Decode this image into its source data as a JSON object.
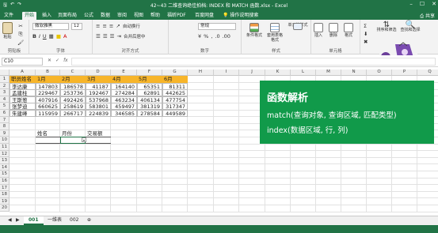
{
  "titlebar": {
    "title": "42~43 二维查询绝佳拍档: INDEX 和 MATCH 函数.xlsx - Excel"
  },
  "ribbon_tabs": [
    "文件",
    "开始",
    "插入",
    "页面布局",
    "公式",
    "数据",
    "审阅",
    "视图",
    "帮助",
    "福昕PDF",
    "百度网盘",
    "操作说明搜索"
  ],
  "share_label": "共享",
  "ribbon": {
    "paste": "粘贴",
    "font_name": "微软雅黑",
    "font_size": "12",
    "wrap": "自动换行",
    "merge": "合并后居中",
    "number_format": "常规",
    "cond_format": "条件格式",
    "as_table": "套用表格格式",
    "cell_style": "单元格样式",
    "insert": "插入",
    "delete": "删除",
    "format": "格式",
    "sort_filter": "排序和筛选",
    "find_select": "查找和选择",
    "groups": [
      "剪贴板",
      "字体",
      "对齐方式",
      "数字",
      "样式",
      "单元格",
      "编辑"
    ]
  },
  "name_box": "C10",
  "columns": [
    "A",
    "B",
    "C",
    "D",
    "E",
    "F",
    "G",
    "H",
    "I",
    "J",
    "K",
    "L",
    "M",
    "N",
    "O",
    "P",
    "Q"
  ],
  "rows": [
    "1",
    "2",
    "3",
    "4",
    "5",
    "6",
    "7",
    "8",
    "9",
    "10",
    "11",
    "12",
    "13",
    "14",
    "15",
    "16",
    "17",
    "18",
    "19",
    "20"
  ],
  "table": {
    "headers": [
      "职员姓名",
      "1月",
      "2月",
      "3月",
      "4月",
      "5月",
      "6月"
    ],
    "rows": [
      [
        "李达康",
        "147803",
        "186578",
        "41187",
        "164140",
        "65351",
        "81311"
      ],
      [
        "孟建柱",
        "229467",
        "253736",
        "192467",
        "274284",
        "62891",
        "442625"
      ],
      [
        "王斯葱",
        "407916",
        "492426",
        "537968",
        "463234",
        "406134",
        "477754"
      ],
      [
        "张梦迪",
        "660625",
        "258619",
        "583801",
        "459497",
        "381319",
        "317347"
      ],
      [
        "朱建峰",
        "115959",
        "266717",
        "224839",
        "346585",
        "278584",
        "449589"
      ]
    ]
  },
  "query": {
    "headers": [
      "姓名",
      "月份",
      "交易额"
    ]
  },
  "panel": {
    "title": "函数解析",
    "line1": "match(查询对象, 查询区域, 匹配类型)",
    "line2": "index(数据区域, 行, 列)"
  },
  "sheets": [
    "001",
    "一维表",
    "002"
  ],
  "colors": {
    "excel_green": "#217346",
    "header_orange": "#f7b52a",
    "panel_green": "#119a4a"
  }
}
